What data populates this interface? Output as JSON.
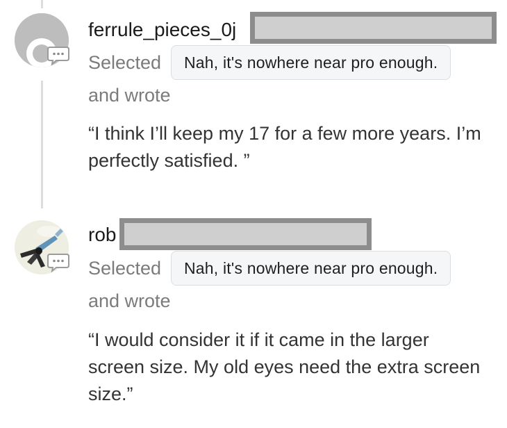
{
  "comments": [
    {
      "username": "ferrule_pieces_0j",
      "avatar_icon": "default-profile-icon",
      "badge_icon": "comment-bubble-icon",
      "selected_label": "Selected",
      "selected_answer": "Nah, it's nowhere near pro enough.",
      "and_wrote_label": "and wrote",
      "quote": "“I think I’ll keep my 17 for a few more years. I’m perfectly satisfied. ”"
    },
    {
      "username": "rob",
      "avatar_icon": "profile-photo",
      "badge_icon": "comment-bubble-icon",
      "selected_label": "Selected",
      "selected_answer": "Nah, it's nowhere near pro enough.",
      "and_wrote_label": "and wrote",
      "quote": "“I would consider it if it came in the larger screen size. My old eyes need the extra screen size.”"
    }
  ],
  "colors": {
    "thread_line": "#dddddd",
    "muted_text": "#7b7b7b",
    "chip_background": "#f5f6f8",
    "redaction_fill": "#cfcfcf",
    "redaction_border": "#8d8d8d"
  }
}
